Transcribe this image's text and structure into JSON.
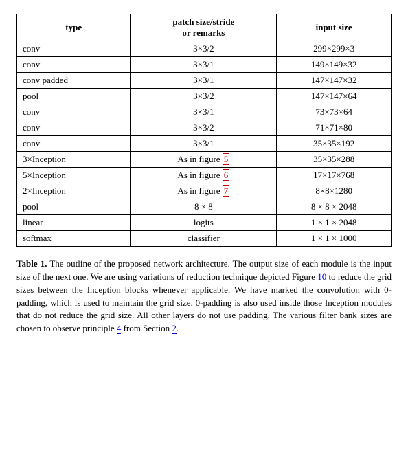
{
  "table": {
    "headers": [
      {
        "label": "type",
        "colspan": 1
      },
      {
        "label": "patch size/stride\nor remarks",
        "colspan": 1
      },
      {
        "label": "input size",
        "colspan": 1
      }
    ],
    "rows": [
      {
        "type": "conv",
        "patch": "3×3/2",
        "input": "299×299×3"
      },
      {
        "type": "conv",
        "patch": "3×3/1",
        "input": "149×149×32"
      },
      {
        "type": "conv padded",
        "patch": "3×3/1",
        "input": "147×147×32"
      },
      {
        "type": "pool",
        "patch": "3×3/2",
        "input": "147×147×64"
      },
      {
        "type": "conv",
        "patch": "3×3/1",
        "input": "73×73×64"
      },
      {
        "type": "conv",
        "patch": "3×3/2",
        "input": "71×71×80"
      },
      {
        "type": "conv",
        "patch": "3×3/1",
        "input": "35×35×192"
      },
      {
        "type": "3×Inception",
        "patch": "As in figure 5",
        "input": "35×35×288",
        "highlight": true
      },
      {
        "type": "5×Inception",
        "patch": "As in figure 6",
        "input": "17×17×768",
        "highlight": true
      },
      {
        "type": "2×Inception",
        "patch": "As in figure 7",
        "input": "8×8×1280",
        "highlight": true
      },
      {
        "type": "pool",
        "patch": "8 × 8",
        "input": "8 × 8 × 2048"
      },
      {
        "type": "linear",
        "patch": "logits",
        "input": "1 × 1 × 2048"
      },
      {
        "type": "softmax",
        "patch": "classifier",
        "input": "1 × 1 × 1000"
      }
    ]
  },
  "caption": {
    "label": "Table 1.",
    "text_parts": [
      " The outline of the proposed network architecture.  The output size of each module is the input size of the next one.  We are using variations of reduction technique depicted Figure ",
      " to reduce the grid sizes between the Inception blocks whenever applicable.  We have marked the convolution with 0-padding, which is used to maintain the grid size.  0-padding is also used inside those Inception modules that do not reduce the grid size.  All other layers do not use padding.  The various filter bank sizes are chosen to observe principle ",
      " from Section ",
      "."
    ],
    "link1": "10",
    "link2": "4",
    "link3": "2"
  },
  "highlighted_figures": [
    "5",
    "6",
    "7"
  ]
}
